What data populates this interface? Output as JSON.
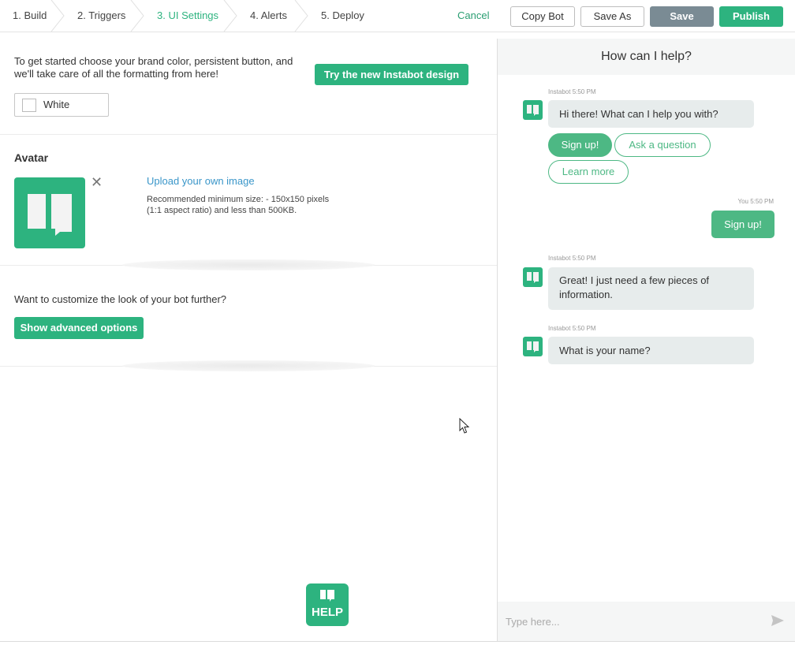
{
  "nav": {
    "steps": [
      {
        "label": "1. Build"
      },
      {
        "label": "2. Triggers"
      },
      {
        "label": "3. UI Settings"
      },
      {
        "label": "4. Alerts"
      },
      {
        "label": "5. Deploy"
      }
    ],
    "cancel_label": "Cancel",
    "copy_bot_label": "Copy Bot",
    "save_as_label": "Save As",
    "save_label": "Save",
    "publish_label": "Publish"
  },
  "branding": {
    "intro_text": "To get started choose your brand color, persistent button, and we'll take care of all the formatting from here!",
    "try_design_label": "Try the new Instabot design",
    "color_value": "White"
  },
  "avatar": {
    "title": "Avatar",
    "upload_label": "Upload your own image",
    "recommendation": "Recommended minimum size: - 150x150 pixels (1:1 aspect ratio) and less than 500KB."
  },
  "advanced": {
    "prompt": "Want to customize the look of your bot further?",
    "button_label": "Show advanced options"
  },
  "help": {
    "label": "HELP"
  },
  "chat": {
    "header": "How can I help?",
    "messages": [
      {
        "meta": "Instabot 5:50 PM",
        "text": "Hi there! What can I help you with?"
      },
      {
        "meta": "You 5:50 PM",
        "text": "Sign up!"
      },
      {
        "meta": "Instabot 5:50 PM",
        "text": "Great! I just need a few pieces of information."
      },
      {
        "meta": "Instabot 5:50 PM",
        "text": "What is your name?"
      }
    ],
    "quick_replies": [
      "Sign up!",
      "Ask a question",
      "Learn more"
    ],
    "input_placeholder": "Type here..."
  },
  "colors": {
    "accent": "#2db37f",
    "chat_accent": "#4db884",
    "save_gray": "#7a8b94",
    "link_blue": "#3a96c9"
  }
}
